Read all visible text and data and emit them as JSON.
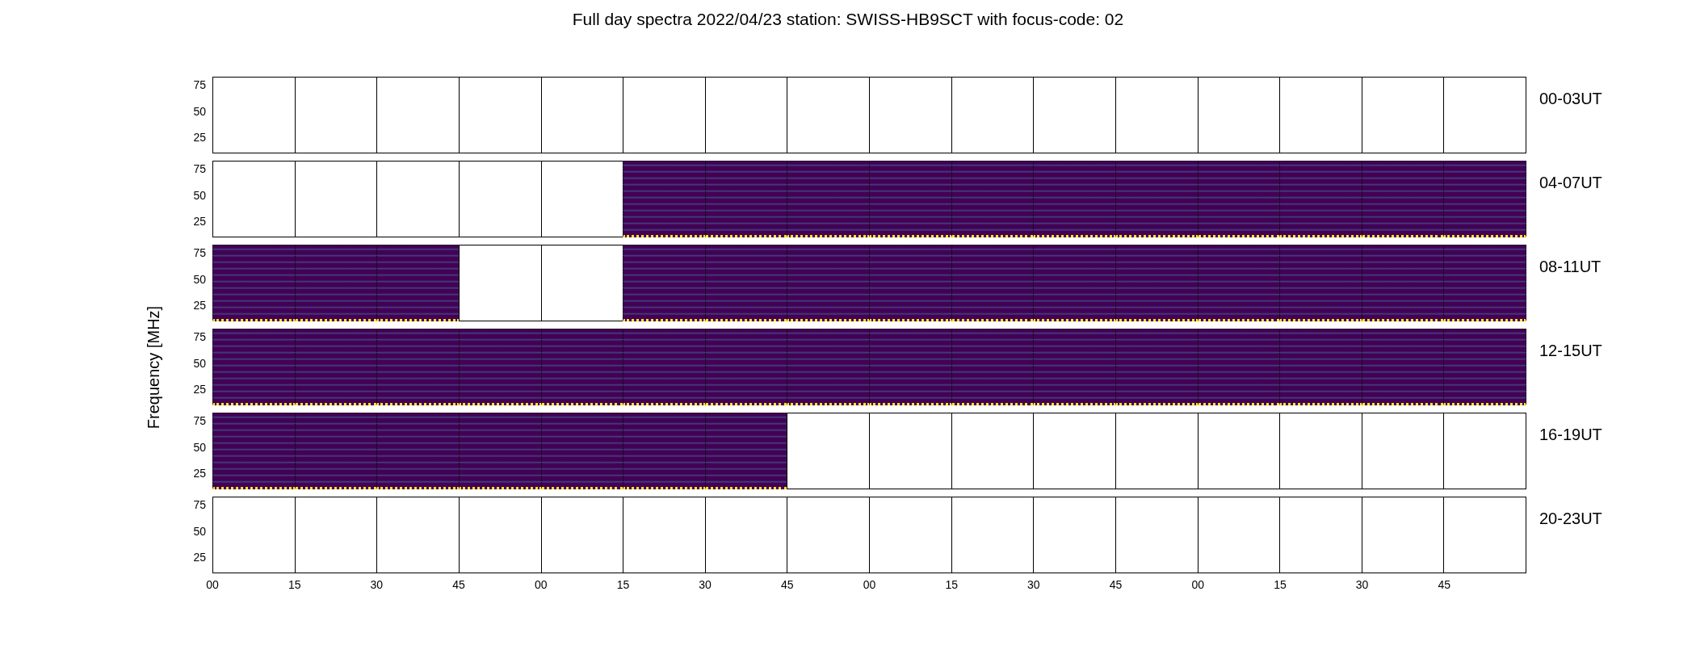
{
  "title": "Full day spectra 2022/04/23 station: SWISS-HB9SCT with focus-code: 02",
  "ylabel": "Frequency [MHz]",
  "rows": [
    {
      "label": "00-03UT",
      "yticks": [
        "75",
        "50",
        "25"
      ],
      "panels": [
        false,
        false,
        false,
        false,
        false,
        false,
        false,
        false,
        false,
        false,
        false,
        false,
        false,
        false,
        false,
        false
      ]
    },
    {
      "label": "04-07UT",
      "yticks": [
        "75",
        "50",
        "25"
      ],
      "panels": [
        false,
        false,
        false,
        false,
        false,
        true,
        true,
        true,
        true,
        true,
        true,
        true,
        true,
        true,
        true,
        true
      ]
    },
    {
      "label": "08-11UT",
      "yticks": [
        "75",
        "50",
        "25"
      ],
      "panels": [
        true,
        true,
        true,
        false,
        false,
        true,
        true,
        true,
        true,
        true,
        true,
        true,
        true,
        true,
        true,
        true
      ]
    },
    {
      "label": "12-15UT",
      "yticks": [
        "75",
        "50",
        "25"
      ],
      "panels": [
        true,
        true,
        true,
        true,
        true,
        true,
        true,
        true,
        true,
        true,
        true,
        true,
        true,
        true,
        true,
        true
      ]
    },
    {
      "label": "16-19UT",
      "yticks": [
        "75",
        "50",
        "25"
      ],
      "panels": [
        true,
        true,
        true,
        true,
        true,
        true,
        true,
        false,
        false,
        false,
        false,
        false,
        false,
        false,
        false,
        false
      ]
    },
    {
      "label": "20-23UT",
      "yticks": [
        "75",
        "50",
        "25"
      ],
      "panels": [
        false,
        false,
        false,
        false,
        false,
        false,
        false,
        false,
        false,
        false,
        false,
        false,
        false,
        false,
        false,
        false
      ]
    }
  ],
  "xticks": [
    "00",
    "15",
    "30",
    "45",
    "00",
    "15",
    "30",
    "45",
    "00",
    "15",
    "30",
    "45",
    "00",
    "15",
    "30",
    "45"
  ]
}
